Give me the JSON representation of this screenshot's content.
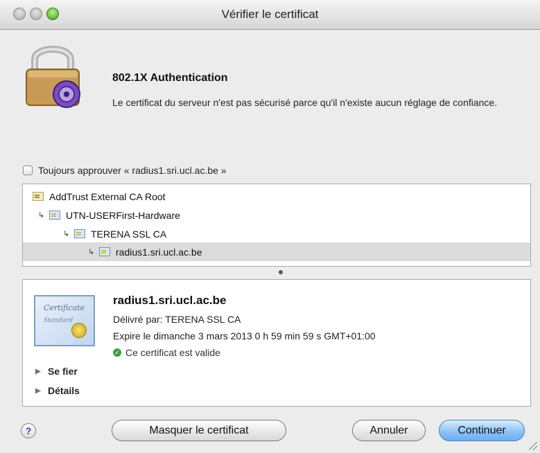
{
  "window": {
    "title": "Vérifier le certificat"
  },
  "header": {
    "heading": "802.1X Authentication",
    "message": "Le certificat du serveur n'est pas sécurisé parce qu'il n'existe aucun réglage de confiance."
  },
  "always_trust": {
    "label": "Toujours approuver « radius1.sri.ucl.ac.be »",
    "checked": false
  },
  "chain": [
    {
      "label": "AddTrust External CA Root"
    },
    {
      "label": "UTN-USERFirst-Hardware"
    },
    {
      "label": "TERENA SSL CA"
    },
    {
      "label": "radius1.sri.ucl.ac.be",
      "selected": true
    }
  ],
  "certificate": {
    "image_title": "Certificate",
    "image_subtitle": "Standard",
    "common_name": "radius1.sri.ucl.ac.be",
    "issuer": "Délivré par: TERENA SSL CA",
    "expires": "Expire le dimanche 3 mars 2013 0 h 59 min 59 s GMT+01:00",
    "status": "Ce certificat est valide",
    "trust_label": "Se fier",
    "details_label": "Détails"
  },
  "buttons": {
    "help": "?",
    "show_cert": "Masquer le certificat",
    "cancel": "Annuler",
    "continue": "Continuer"
  },
  "colors": {
    "default_button": "#8fc3f6",
    "valid_status": "#3ca33c",
    "selection": "#dcdcdc"
  }
}
